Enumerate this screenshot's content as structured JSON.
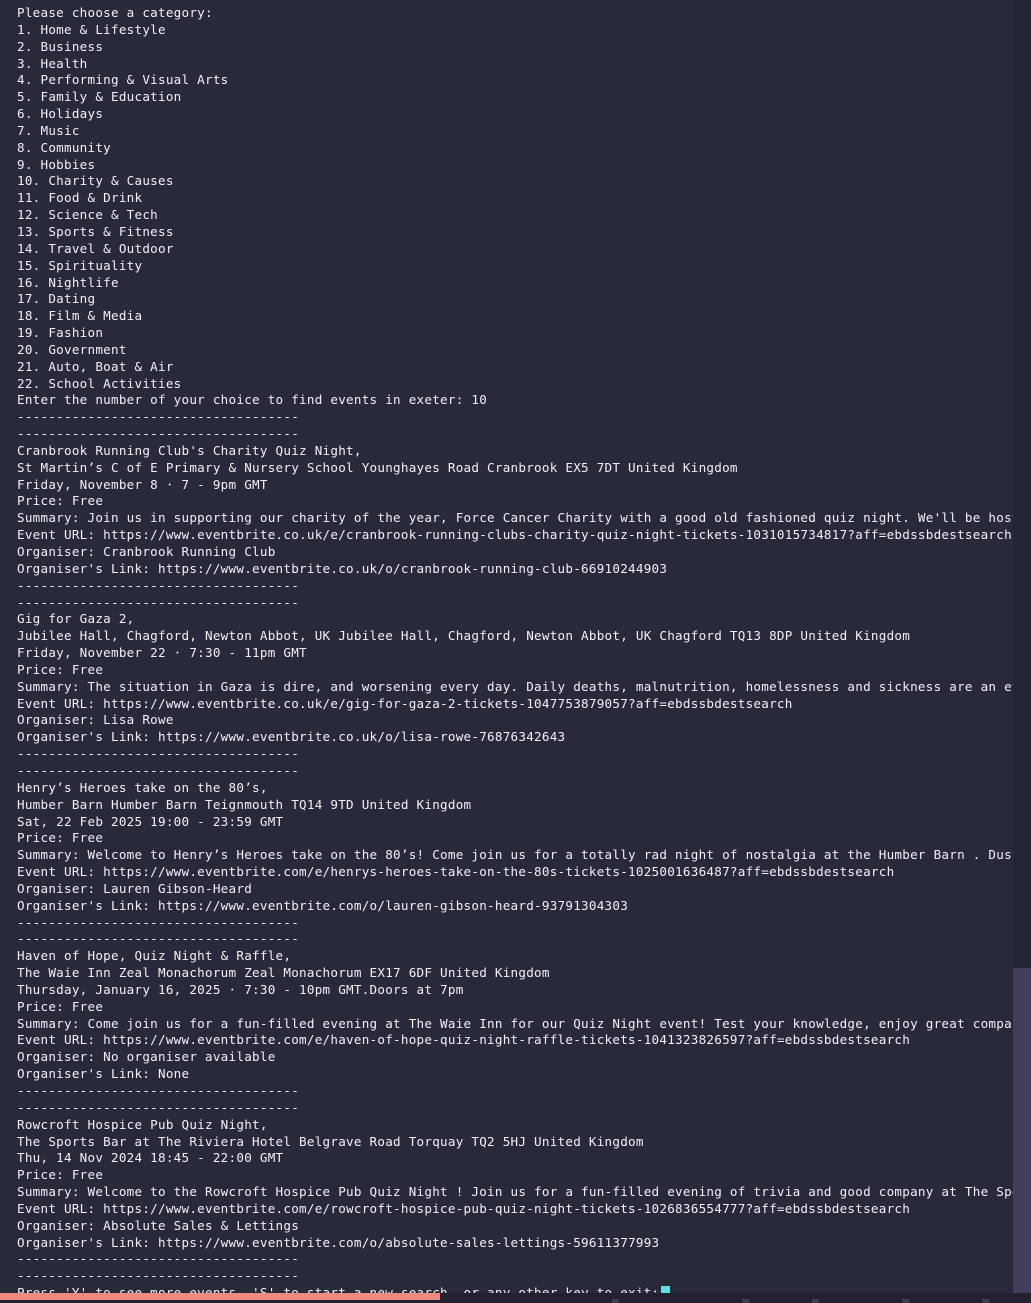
{
  "terminal": {
    "prompt_header": "Please choose a category:",
    "categories": [
      "1. Home & Lifestyle",
      "2. Business",
      "3. Health",
      "4. Performing & Visual Arts",
      "5. Family & Education",
      "6. Holidays",
      "7. Music",
      "8. Community",
      "9. Hobbies",
      "10. Charity & Causes",
      "11. Food & Drink",
      "12. Science & Tech",
      "13. Sports & Fitness",
      "14. Travel & Outdoor",
      "15. Spirituality",
      "16. Nightlife",
      "17. Dating",
      "18. Film & Media",
      "19. Fashion",
      "20. Government",
      "21. Auto, Boat & Air",
      "22. School Activities"
    ],
    "choice_prompt": "Enter the number of your choice to find events in exeter: 10",
    "separator": "------------------------------------",
    "events": [
      {
        "title": "Cranbrook Running Club's Charity Quiz Night,",
        "venue": "St Martin’s C of E Primary & Nursery School Younghayes Road Cranbrook EX5 7DT United Kingdom",
        "datetime": "Friday, November 8 · 7 - 9pm GMT",
        "price": "Price: Free",
        "summary": "Summary: Join us in supporting our charity of the year, Force Cancer Charity with a good old fashioned quiz night. We'll be hosti...",
        "event_url": "Event URL: https://www.eventbrite.co.uk/e/cranbrook-running-clubs-charity-quiz-night-tickets-1031015734817?aff=ebdssbdestsearch",
        "organiser": "Organiser: Cranbrook Running Club",
        "organiser_link": "Organiser's Link: https://www.eventbrite.co.uk/o/cranbrook-running-club-66910244903"
      },
      {
        "title": "Gig for Gaza 2,",
        "venue": "Jubilee Hall, Chagford, Newton Abbot, UK Jubilee Hall, Chagford, Newton Abbot, UK Chagford TQ13 8DP United Kingdom",
        "datetime": "Friday, November 22 · 7:30 - 11pm GMT",
        "price": "Price: Free",
        "summary": "Summary: The situation in Gaza is dire, and worsening every day. Daily deaths, malnutrition, homelessness and sickness are an eve...",
        "event_url": "Event URL: https://www.eventbrite.co.uk/e/gig-for-gaza-2-tickets-1047753879057?aff=ebdssbdestsearch",
        "organiser": "Organiser: Lisa Rowe",
        "organiser_link": "Organiser's Link: https://www.eventbrite.co.uk/o/lisa-rowe-76876342643"
      },
      {
        "title": "Henry’s Heroes take on the 80’s,",
        "venue": "Humber Barn Humber Barn Teignmouth TQ14 9TD United Kingdom",
        "datetime": "Sat, 22 Feb 2025 19:00 - 23:59 GMT",
        "price": "Price: Free",
        "summary": "Summary: Welcome to Henry’s Heroes take on the 80’s! Come join us for a totally rad night of nostalgia at the Humber Barn . Dust ...",
        "event_url": "Event URL: https://www.eventbrite.com/e/henrys-heroes-take-on-the-80s-tickets-1025001636487?aff=ebdssbdestsearch",
        "organiser": "Organiser: Lauren Gibson-Heard",
        "organiser_link": "Organiser's Link: https://www.eventbrite.com/o/lauren-gibson-heard-93791304303"
      },
      {
        "title": "Haven of Hope, Quiz Night & Raffle,",
        "venue": "The Waie Inn Zeal Monachorum Zeal Monachorum EX17 6DF United Kingdom",
        "datetime": "Thursday, January 16, 2025 · 7:30 - 10pm GMT.Doors at 7pm",
        "price": "Price: Free",
        "summary": "Summary: Come join us for a fun-filled evening at The Waie Inn for our Quiz Night event! Test your knowledge, enjoy great company...",
        "event_url": "Event URL: https://www.eventbrite.com/e/haven-of-hope-quiz-night-raffle-tickets-1041323826597?aff=ebdssbdestsearch",
        "organiser": "Organiser: No organiser available",
        "organiser_link": "Organiser's Link: None"
      },
      {
        "title": "Rowcroft Hospice Pub Quiz Night,",
        "venue": "The Sports Bar at The Riviera Hotel Belgrave Road Torquay TQ2 5HJ United Kingdom",
        "datetime": "Thu, 14 Nov 2024 18:45 - 22:00 GMT",
        "price": "Price: Free",
        "summary": "Summary: Welcome to the Rowcroft Hospice Pub Quiz Night ! Join us for a fun-filled evening of trivia and good company at The Spor...",
        "event_url": "Event URL: https://www.eventbrite.com/e/rowcroft-hospice-pub-quiz-night-tickets-1026836554777?aff=ebdssbdestsearch",
        "organiser": "Organiser: Absolute Sales & Lettings",
        "organiser_link": "Organiser's Link: https://www.eventbrite.com/o/absolute-sales-lettings-59611377993"
      }
    ],
    "footer_prompt": "Press 'Y' to see more events, 'S' to start a new search, or any other key to exit:",
    "colors": {
      "background": "#282a3a",
      "text": "#f0f0f5",
      "cursor": "#5ce1e6",
      "scrollbar_thumb": "#423f5e",
      "taskbar_active": "#f08a7e"
    }
  }
}
